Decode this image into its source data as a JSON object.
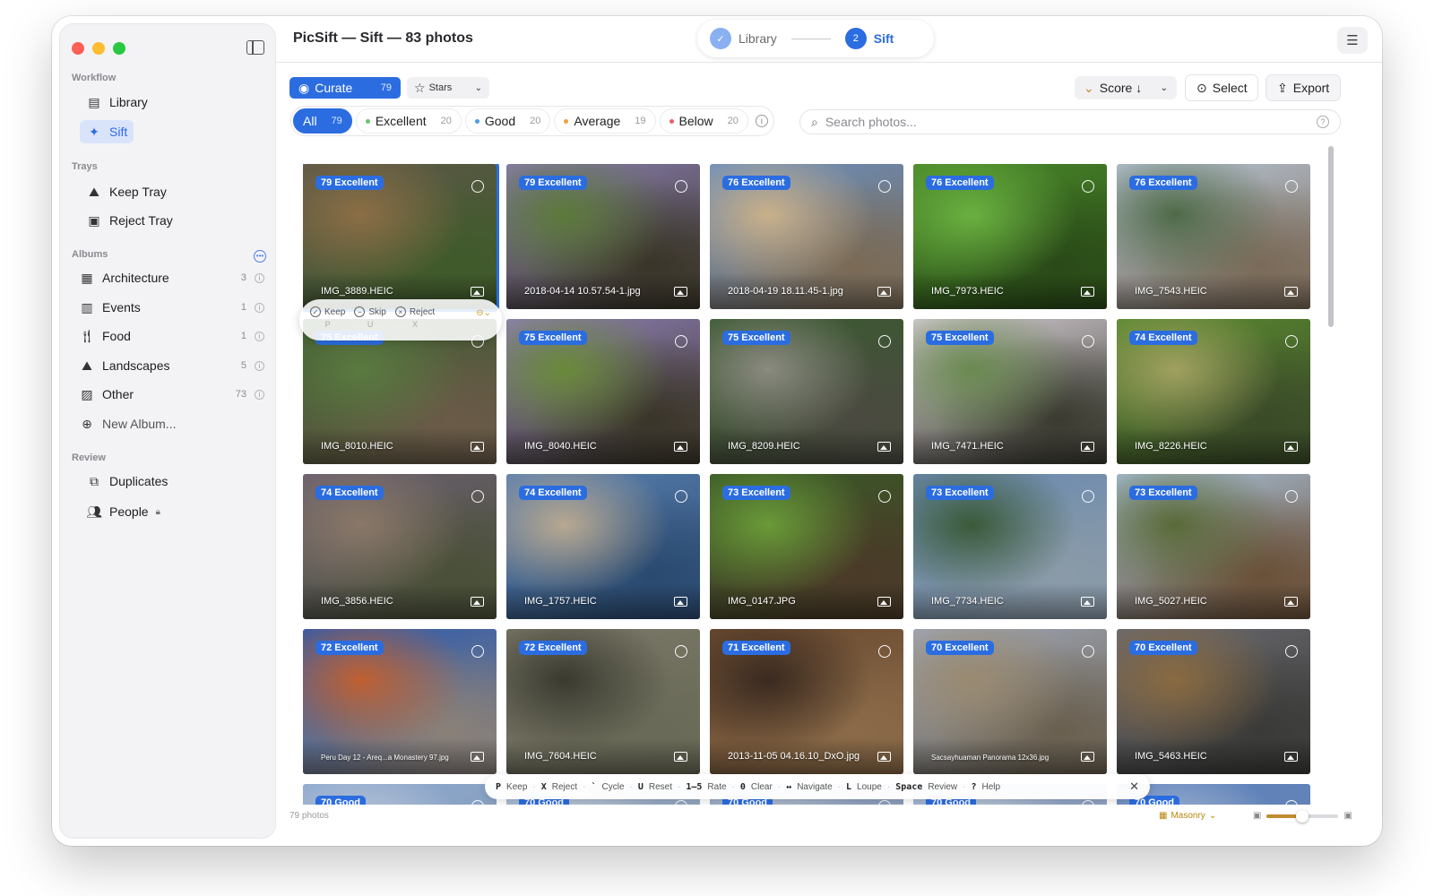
{
  "window": {
    "title": "PicSift — Sift — 83 photos"
  },
  "stepper": {
    "step1_label": "Library",
    "step1_icon": "check-icon",
    "step2_num": "2",
    "step2_label": "Sift"
  },
  "sidebar": {
    "workflow_title": "Workflow",
    "workflow": [
      {
        "label": "Library",
        "icon": "library-icon"
      },
      {
        "label": "Sift",
        "icon": "sparkle-icon"
      }
    ],
    "trays_title": "Trays",
    "trays": [
      {
        "label": "Keep Tray",
        "icon": "keep-tray-icon"
      },
      {
        "label": "Reject Tray",
        "icon": "reject-tray-icon"
      }
    ],
    "albums_title": "Albums",
    "albums": [
      {
        "label": "Architecture",
        "count": "3"
      },
      {
        "label": "Events",
        "count": "1"
      },
      {
        "label": "Food",
        "count": "1"
      },
      {
        "label": "Landscapes",
        "count": "5"
      },
      {
        "label": "Other",
        "count": "73"
      }
    ],
    "new_album": "New Album...",
    "review_title": "Review",
    "review": [
      {
        "label": "Duplicates"
      },
      {
        "label": "People"
      }
    ]
  },
  "toolbar": {
    "curate_label": "Curate",
    "curate_count": "79",
    "stars_label": "Stars",
    "score_label": "Score ↓",
    "select_label": "Select",
    "export_label": "Export"
  },
  "filters": [
    {
      "label": "All",
      "count": "79",
      "color": ""
    },
    {
      "label": "Excellent",
      "count": "20",
      "color": "#6cc36c"
    },
    {
      "label": "Good",
      "count": "20",
      "color": "#4c9bf0"
    },
    {
      "label": "Average",
      "count": "19",
      "color": "#f0a040"
    },
    {
      "label": "Below",
      "count": "20",
      "color": "#e86060"
    }
  ],
  "search": {
    "placeholder": "Search photos..."
  },
  "hover_bar": {
    "keep": "Keep",
    "keep_key": "P",
    "skip": "Skip",
    "skip_key": "U",
    "reject": "Reject",
    "reject_key": "X"
  },
  "photos": [
    {
      "badge": "79 Excellent",
      "name": "IMG_3889.HEIC",
      "palette": [
        "#5c5848",
        "#8b6e45",
        "#3f5a2b"
      ]
    },
    {
      "badge": "79 Excellent",
      "name": "2018-04-14 10.57.54-1.jpg",
      "palette": [
        "#8a7eb0",
        "#5c7a3a",
        "#3a3528"
      ]
    },
    {
      "badge": "76 Excellent",
      "name": "2018-04-19 18.11.45-1.jpg",
      "palette": [
        "#6a8fc0",
        "#c9b08a",
        "#7a6a55"
      ]
    },
    {
      "badge": "76 Excellent",
      "name": "IMG_7973.HEIC",
      "palette": [
        "#4a8a2a",
        "#6ab040",
        "#2a4a18"
      ]
    },
    {
      "badge": "76 Excellent",
      "name": "IMG_7543.HEIC",
      "palette": [
        "#b9c7d8",
        "#4f6a48",
        "#7a6a58"
      ]
    },
    {
      "badge": "75 Excellent",
      "name": "IMG_8010.HEIC",
      "palette": [
        "#3c5a30",
        "#5a7a40",
        "#6a5a48"
      ]
    },
    {
      "badge": "75 Excellent",
      "name": "IMG_8040.HEIC",
      "palette": [
        "#9080b8",
        "#6a8a3a",
        "#3a3528"
      ]
    },
    {
      "badge": "75 Excellent",
      "name": "IMG_8209.HEIC",
      "palette": [
        "#3a5a30",
        "#8a8a80",
        "#4a4a40"
      ]
    },
    {
      "badge": "75 Excellent",
      "name": "IMG_7471.HEIC",
      "palette": [
        "#d8d0d8",
        "#6a8a50",
        "#3a3a30"
      ]
    },
    {
      "badge": "74 Excellent",
      "name": "IMG_8226.HEIC",
      "palette": [
        "#5a8a30",
        "#a0a060",
        "#3a4a28"
      ]
    },
    {
      "badge": "74 Excellent",
      "name": "IMG_3856.HEIC",
      "palette": [
        "#6a6070",
        "#8a7868",
        "#4a5038"
      ]
    },
    {
      "badge": "74 Excellent",
      "name": "IMG_1757.HEIC",
      "palette": [
        "#5a80b0",
        "#b8a890",
        "#2a4a70"
      ]
    },
    {
      "badge": "73 Excellent",
      "name": "IMG_0147.JPG",
      "palette": [
        "#3a5a28",
        "#6a9a38",
        "#4a3a28"
      ]
    },
    {
      "badge": "73 Excellent",
      "name": "IMG_7734.HEIC",
      "palette": [
        "#6a8ab0",
        "#3a5a38",
        "#8a9aa8"
      ]
    },
    {
      "badge": "73 Excellent",
      "name": "IMG_5027.HEIC",
      "palette": [
        "#a8c0d8",
        "#5a6a38",
        "#6a5038"
      ]
    },
    {
      "badge": "72 Excellent",
      "name": "Peru Day 12 - Areq...a Monastery 97.jpg",
      "palette": [
        "#2a5ab0",
        "#c06030",
        "#8a8078"
      ]
    },
    {
      "badge": "72 Excellent",
      "name": "IMG_7604.HEIC",
      "palette": [
        "#7a7868",
        "#3a3a30",
        "#6a6a58"
      ]
    },
    {
      "badge": "71 Excellent",
      "name": "2013-11-05 04.16.10_DxO.jpg",
      "palette": [
        "#6a4a30",
        "#3a2a20",
        "#8a6a48"
      ]
    },
    {
      "badge": "70 Excellent",
      "name": "Sacsayhuaman Panorama 12x36.jpg",
      "palette": [
        "#a0a8b8",
        "#9a8a70",
        "#6a6050"
      ]
    },
    {
      "badge": "70 Excellent",
      "name": "IMG_5463.HEIC",
      "palette": [
        "#6a6a70",
        "#8a6a40",
        "#3a3a38"
      ]
    },
    {
      "badge": "70 Good",
      "name": "",
      "palette": [
        "#8aa8d0",
        "#c0c8d8",
        "#8a9ab0"
      ]
    },
    {
      "badge": "70 Good",
      "name": "",
      "palette": [
        "#9ab0d0",
        "#c8d0d8",
        "#8a98a8"
      ]
    },
    {
      "badge": "70 Good",
      "name": "",
      "palette": [
        "#8aa0c8",
        "#c0c8d0",
        "#909aa8"
      ]
    },
    {
      "badge": "70 Good",
      "name": "",
      "palette": [
        "#90a8d0",
        "#c8d0d8",
        "#8a98a8"
      ]
    },
    {
      "badge": "70 Good",
      "name": "",
      "palette": [
        "#5a80c0",
        "#a8b8d0",
        "#7088a8"
      ]
    }
  ],
  "shortcuts": [
    {
      "key": "P",
      "label": "Keep"
    },
    {
      "key": "X",
      "label": "Reject"
    },
    {
      "key": "`",
      "label": "Cycle"
    },
    {
      "key": "U",
      "label": "Reset"
    },
    {
      "key": "1–5",
      "label": "Rate"
    },
    {
      "key": "0",
      "label": "Clear"
    },
    {
      "key": "↔",
      "label": "Navigate"
    },
    {
      "key": "L",
      "label": "Loupe"
    },
    {
      "key": "Space",
      "label": "Review"
    },
    {
      "key": "?",
      "label": "Help"
    }
  ],
  "status": {
    "count": "79 photos",
    "layout": "Masonry",
    "zoom_level": 0.5
  },
  "colors": {
    "accent": "#2b6de0",
    "sidebar_bg": "#f3f3f6"
  }
}
